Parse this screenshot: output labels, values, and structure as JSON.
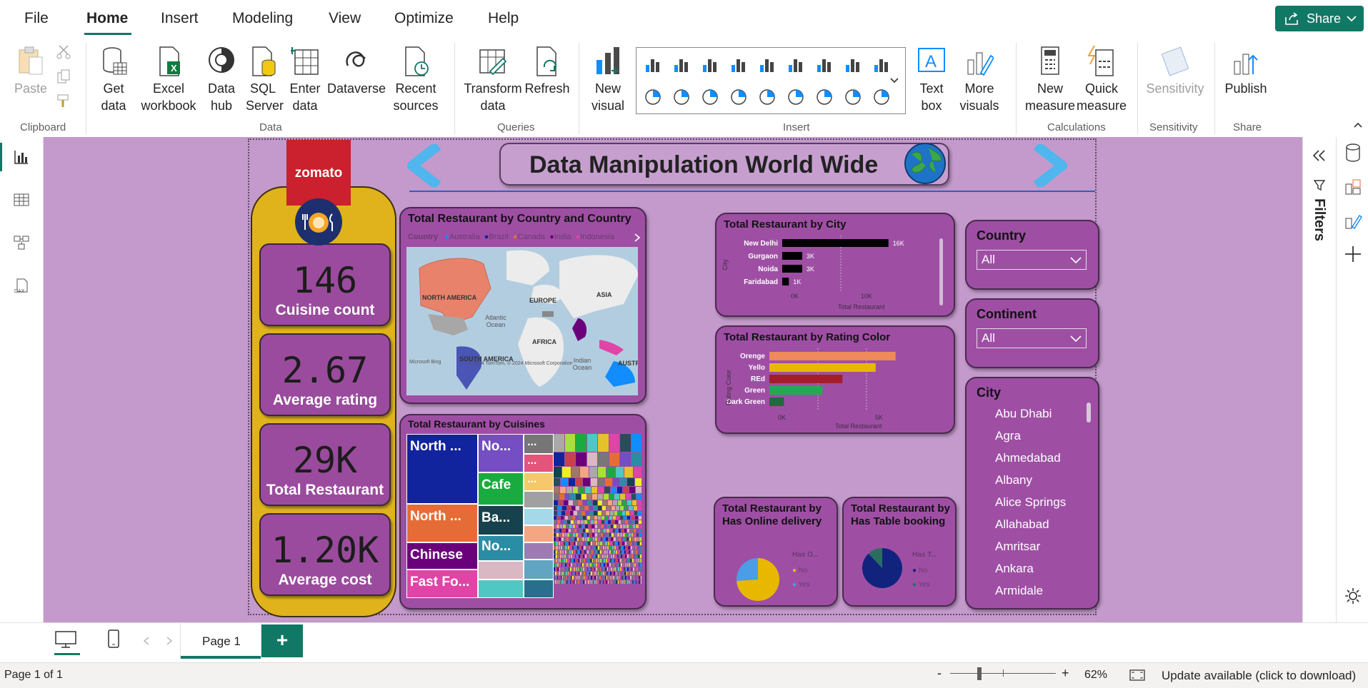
{
  "menu": {
    "items": [
      "File",
      "Home",
      "Insert",
      "Modeling",
      "View",
      "Optimize",
      "Help"
    ],
    "share_label": "Share"
  },
  "ribbon": {
    "clipboard": {
      "paste": "Paste",
      "group": "Clipboard"
    },
    "data": {
      "get_data": "Get data",
      "excel": "Excel workbook",
      "data_hub": "Data hub",
      "sql": "SQL Server",
      "enter": "Enter data",
      "dataverse": "Dataverse",
      "recent": "Recent sources",
      "group": "Data"
    },
    "queries": {
      "transform": "Transform data",
      "refresh": "Refresh",
      "group": "Queries"
    },
    "insert": {
      "new_visual": "New visual",
      "text_box": "Text box",
      "more_visuals": "More visuals",
      "group": "Insert"
    },
    "calculations": {
      "new_measure": "New measure",
      "quick_measure": "Quick measure",
      "group": "Calculations"
    },
    "sensitivity": {
      "label": "Sensitivity",
      "group": "Sensitivity"
    },
    "share": {
      "publish": "Publish",
      "group": "Share"
    }
  },
  "report": {
    "title": "Data Manipulation World Wide",
    "logo_text": "zomato",
    "kpis": [
      {
        "value": "146",
        "label": "Cuisine count"
      },
      {
        "value": "2.67",
        "label": "Average rating"
      },
      {
        "value": "29K",
        "label": "Total Restaurant"
      },
      {
        "value": "1.20K",
        "label": "Average cost"
      }
    ],
    "map": {
      "title": "Total Restaurant by Country and Country",
      "legend_title": "Country",
      "legend": [
        "Australia",
        "Brazil",
        "Canada",
        "India",
        "Indonesia"
      ],
      "legend_colors": [
        "#118dff",
        "#12239e",
        "#e66c37",
        "#6b007b",
        "#e044a7"
      ],
      "labels": [
        "NORTH AMERICA",
        "EUROPE",
        "ASIA",
        "Atlantic Ocean",
        "AFRICA",
        "SOUTH AMERICA",
        "Indian Ocean",
        "AUSTRAL"
      ],
      "credit": "Microsoft Bing",
      "copyright": "© 2024 TomTom, © 2024 Microsoft Corporation"
    },
    "cuisines": {
      "title": "Total Restaurant by Cuisines",
      "tiles": [
        "North ...",
        "North ...",
        "Chinese",
        "Fast Fo...",
        "No...",
        "Cafe",
        "Ba...",
        "No...",
        "...",
        "...",
        "..."
      ]
    },
    "city_chart": {
      "title": "Total Restaurant by City",
      "y_axis": "City",
      "x_axis": "Total Restaurant",
      "ticks": [
        "0K",
        "10K"
      ]
    },
    "rating_chart": {
      "title": "Total Restaurant by Rating Color",
      "y_axis": "Rating Color",
      "x_axis": "Total Restaurant",
      "ticks": [
        "0K",
        "5K"
      ]
    },
    "online_delivery": {
      "title": "Total Restaurant by Has Online delivery",
      "legend_title": "Has O...",
      "legend": [
        "No",
        "Yes"
      ]
    },
    "table_booking": {
      "title": "Total Restaurant by Has Table booking",
      "legend_title": "Has T...",
      "legend": [
        "No",
        "Yes"
      ]
    },
    "slicers": {
      "country": {
        "title": "Country",
        "value": "All"
      },
      "continent": {
        "title": "Continent",
        "value": "All"
      },
      "city": {
        "title": "City",
        "items": [
          "Abu Dhabi",
          "Agra",
          "Ahmedabad",
          "Albany",
          "Alice Springs",
          "Allahabad",
          "Amritsar",
          "Ankara",
          "Armidale",
          "Athens"
        ]
      }
    }
  },
  "chart_data": [
    {
      "type": "bar",
      "title": "Total Restaurant by City",
      "categories": [
        "New Delhi",
        "Gurgaon",
        "Noida",
        "Faridabad"
      ],
      "values": [
        16000,
        3000,
        3000,
        1000
      ],
      "data_labels": [
        "16K",
        "3K",
        "3K",
        "1K"
      ],
      "xlabel": "Total Restaurant",
      "ylabel": "City",
      "xlim": [
        0,
        17000
      ]
    },
    {
      "type": "bar",
      "title": "Total Restaurant by Rating Color",
      "categories": [
        "Orenge",
        "Yello",
        "REd",
        "Green",
        "Dark Green"
      ],
      "values": [
        9500,
        8000,
        5500,
        4000,
        1100
      ],
      "colors": [
        "#ee8a5b",
        "#e8b800",
        "#a51d2a",
        "#25a94f",
        "#1e6b3e"
      ],
      "xlabel": "Total Restaurant",
      "ylabel": "Rating Color",
      "xlim": [
        0,
        10000
      ]
    },
    {
      "type": "pie",
      "title": "Total Restaurant by Has Online delivery",
      "categories": [
        "No",
        "Yes"
      ],
      "values": [
        74,
        26
      ],
      "colors": [
        "#e8b800",
        "#4a9ee6"
      ]
    },
    {
      "type": "pie",
      "title": "Total Restaurant by Has Table booking",
      "categories": [
        "No",
        "Yes"
      ],
      "values": [
        88,
        12
      ],
      "colors": [
        "#12237e",
        "#2a6e5e"
      ]
    }
  ],
  "pages": {
    "tabs": [
      "Page 1"
    ],
    "add_label": "+"
  },
  "status": {
    "page_info": "Page 1 of 1",
    "zoom": "62%",
    "update": "Update available (click to download)",
    "minus": "-",
    "plus": "+"
  },
  "filters_label": "Filters"
}
